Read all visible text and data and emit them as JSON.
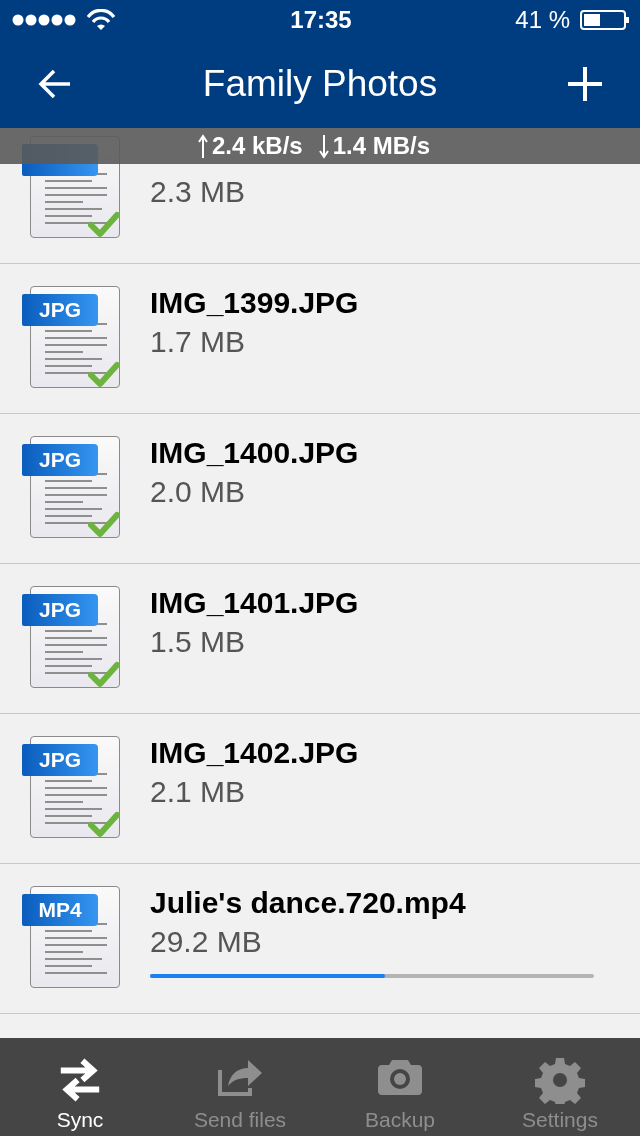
{
  "status_bar": {
    "time": "17:35",
    "battery": "41 %"
  },
  "nav": {
    "title": "Family Photos"
  },
  "transfer": {
    "upload": "2.4 kB/s",
    "download": "1.4 MB/s"
  },
  "files": [
    {
      "size": "2.3 MB",
      "synced": true
    },
    {
      "type": "JPG",
      "name": "IMG_1399.JPG",
      "size": "1.7 MB",
      "synced": true
    },
    {
      "type": "JPG",
      "name": "IMG_1400.JPG",
      "size": "2.0 MB",
      "synced": true
    },
    {
      "type": "JPG",
      "name": "IMG_1401.JPG",
      "size": "1.5 MB",
      "synced": true
    },
    {
      "type": "JPG",
      "name": "IMG_1402.JPG",
      "size": "2.1 MB",
      "synced": true
    },
    {
      "type": "MP4",
      "name": "Julie's dance.720.mp4",
      "size": "29.2 MB",
      "synced": false,
      "level": 0.53
    }
  ],
  "tabs": [
    {
      "kind": "sync",
      "label": "Sync",
      "selected": true
    },
    {
      "kind": "send",
      "label": "Send files",
      "selected": false
    },
    {
      "kind": "backup",
      "label": "Backup",
      "selected": false
    },
    {
      "kind": "settings",
      "label": "Settings",
      "selected": false
    }
  ]
}
